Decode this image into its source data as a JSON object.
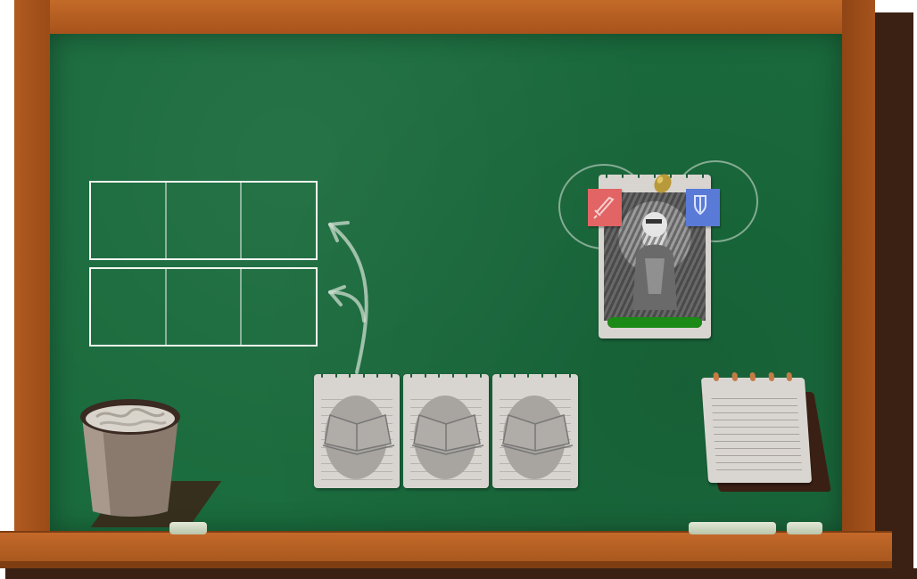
{
  "scene": "chalkboard-card-game",
  "colors": {
    "board": "#1a6b3d",
    "frame": "#b25d22",
    "attack_badge": "#e26464",
    "defense_badge": "#5a7ad8",
    "health_bar": "#1c8a16"
  },
  "board_slots": {
    "rows": 2,
    "columns": 3
  },
  "hero": {
    "health_fraction": 1.0,
    "attack_icon": "sword-icon",
    "defense_icon": "shield-icon"
  },
  "hand": {
    "cards": [
      {
        "icon": "open-book-icon"
      },
      {
        "icon": "open-book-icon"
      },
      {
        "icon": "open-book-icon"
      }
    ]
  },
  "notepad": {
    "icon": "notepad-icon"
  },
  "trash": {
    "icon": "trash-bin-icon"
  }
}
